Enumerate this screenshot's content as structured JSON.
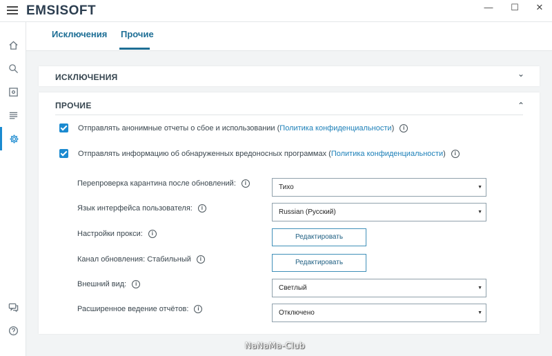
{
  "app": {
    "logo": "EMSISOFT",
    "window_controls": {
      "minimize": "—",
      "maximize": "☐",
      "close": "✕"
    }
  },
  "sidebar": {
    "items": [
      {
        "icon": "home-icon"
      },
      {
        "icon": "search-icon"
      },
      {
        "icon": "quarantine-icon"
      },
      {
        "icon": "logs-icon"
      },
      {
        "icon": "gear-icon",
        "active": true
      },
      {
        "icon": "chat-icon"
      },
      {
        "icon": "help-icon"
      }
    ]
  },
  "tabs": [
    {
      "label": "Исключения"
    },
    {
      "label": "Прочие",
      "active": true
    }
  ],
  "sections": {
    "exclusions": {
      "title": "ИСКЛЮЧЕНИЯ",
      "chevron": "⌄"
    },
    "other": {
      "title": "ПРОЧИЕ",
      "chevron": "⌃"
    }
  },
  "checkboxes": [
    {
      "text": "Отправлять анонимные отчеты о сбое и использовании (",
      "link": "Политика конфиденциальности",
      "close": ")",
      "checked": true
    },
    {
      "text": "Отправлять информацию об обнаруженных вредоносных программах (",
      "link": "Политика конфиденциальности",
      "close": ")",
      "checked": true
    }
  ],
  "settings": [
    {
      "label": "Перепроверка карантина после обновлений:",
      "value": "Тихо"
    },
    {
      "label": "Язык интерфейса пользователя:",
      "value": "Russian (Русский)"
    },
    {
      "label": "Настройки прокси:",
      "button": "Редактировать"
    },
    {
      "label": "Канал обновления: Стабильный",
      "button": "Редактировать"
    },
    {
      "label": "Внешний вид:",
      "value": "Светлый"
    },
    {
      "label": "Расширенное ведение отчётов:",
      "value": "Отключено"
    }
  ],
  "info_glyph": "i",
  "select_arrow": "▼",
  "watermark": "NaNaMa-Club",
  "colors": {
    "accent": "#1b8ad0",
    "tab_text": "#1d6e95",
    "background": "#f2f4f5"
  }
}
